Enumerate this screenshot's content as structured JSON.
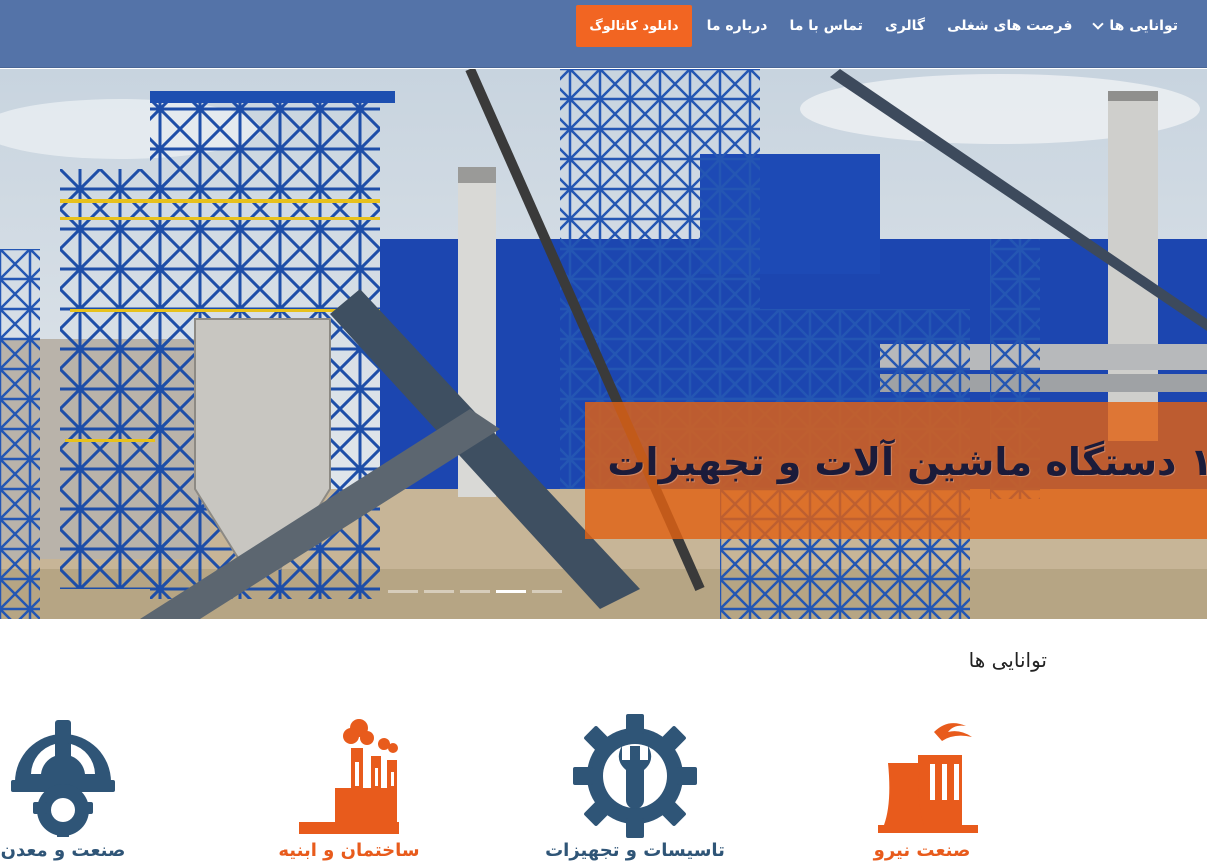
{
  "navbar": {
    "items": [
      {
        "label": "توانایی ها",
        "has_dropdown": true
      },
      {
        "label": "فرصت های شغلی"
      },
      {
        "label": "گالری"
      },
      {
        "label": "تماس با ما"
      },
      {
        "label": "درباره ما"
      }
    ],
    "cta_label": "دانلود کاتالوگ",
    "colors": {
      "bar": "#5473a8",
      "cta": "#f26522"
    }
  },
  "hero": {
    "caption": "۱ دستگاه ماشین آلات و تجهیزات",
    "slide_count": 5,
    "active_slide": 4
  },
  "abilities": {
    "title": "توانایی ها",
    "cards": [
      {
        "label": "صنعت نیرو",
        "icon": "power-plant-icon"
      },
      {
        "label": "تاسیسات و تجهیزات",
        "icon": "gear-wrench-icon"
      },
      {
        "label": "ساختمان و ابنیه",
        "icon": "factory-icon"
      },
      {
        "label": "صنعت و معدن",
        "icon": "hardhat-gear-icon"
      }
    ]
  }
}
